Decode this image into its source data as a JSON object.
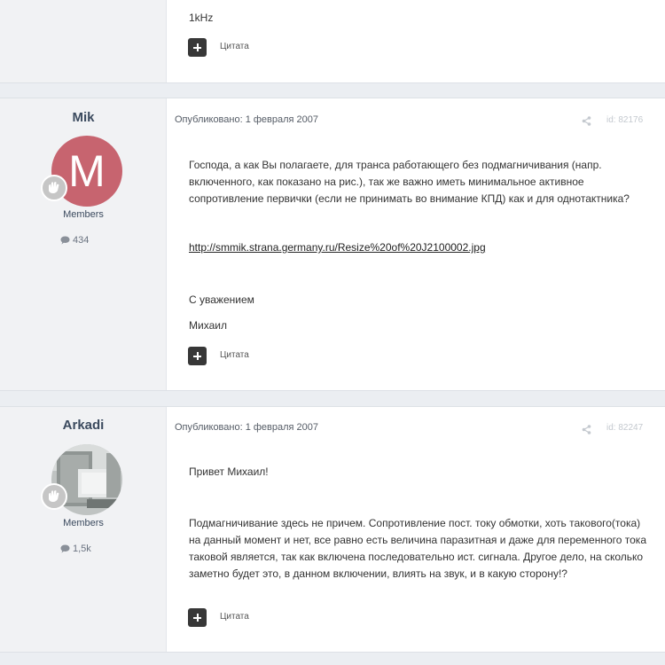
{
  "top_post": {
    "text": "1kHz",
    "quote_label": "Цитата"
  },
  "posts": [
    {
      "author": "Mik",
      "avatar_letter": "M",
      "avatar_color": "#c7646f",
      "group": "Members",
      "post_count": "434",
      "published": "Опубликовано: 1 февраля 2007",
      "post_id": "id: 82176",
      "body": {
        "p1": "Господа, а как Вы полагаете, для транса работающего без подмагничивания (напр. включенного, как показано на рис.), так же важно иметь минимальное активное сопротивление первички (если не принимать во внимание КПД) как и для однотактника?",
        "link": "http://smmik.strana.germany.ru/Resize%20of%20J2100002.jpg",
        "p2": "С уважением",
        "p3": "Михаил"
      },
      "quote_label": "Цитата"
    },
    {
      "author": "Arkadi",
      "group": "Members",
      "post_count": "1,5k",
      "published": "Опубликовано: 1 февраля 2007",
      "post_id": "id: 82247",
      "body": {
        "p1": "Привет Михаил!",
        "p2": "Подмагничивание здесь не причем. Сопротивление пост. току обмотки, хоть такового(тока) на данный момент и нет, все равно есть величина паразитная и даже для переменного тока таковой является, так как включена последовательно ист. сигнала. Другое дело, на сколько заметно будет это, в данном включении, влиять на звук, и в какую сторону!?"
      },
      "quote_label": "Цитата"
    }
  ]
}
